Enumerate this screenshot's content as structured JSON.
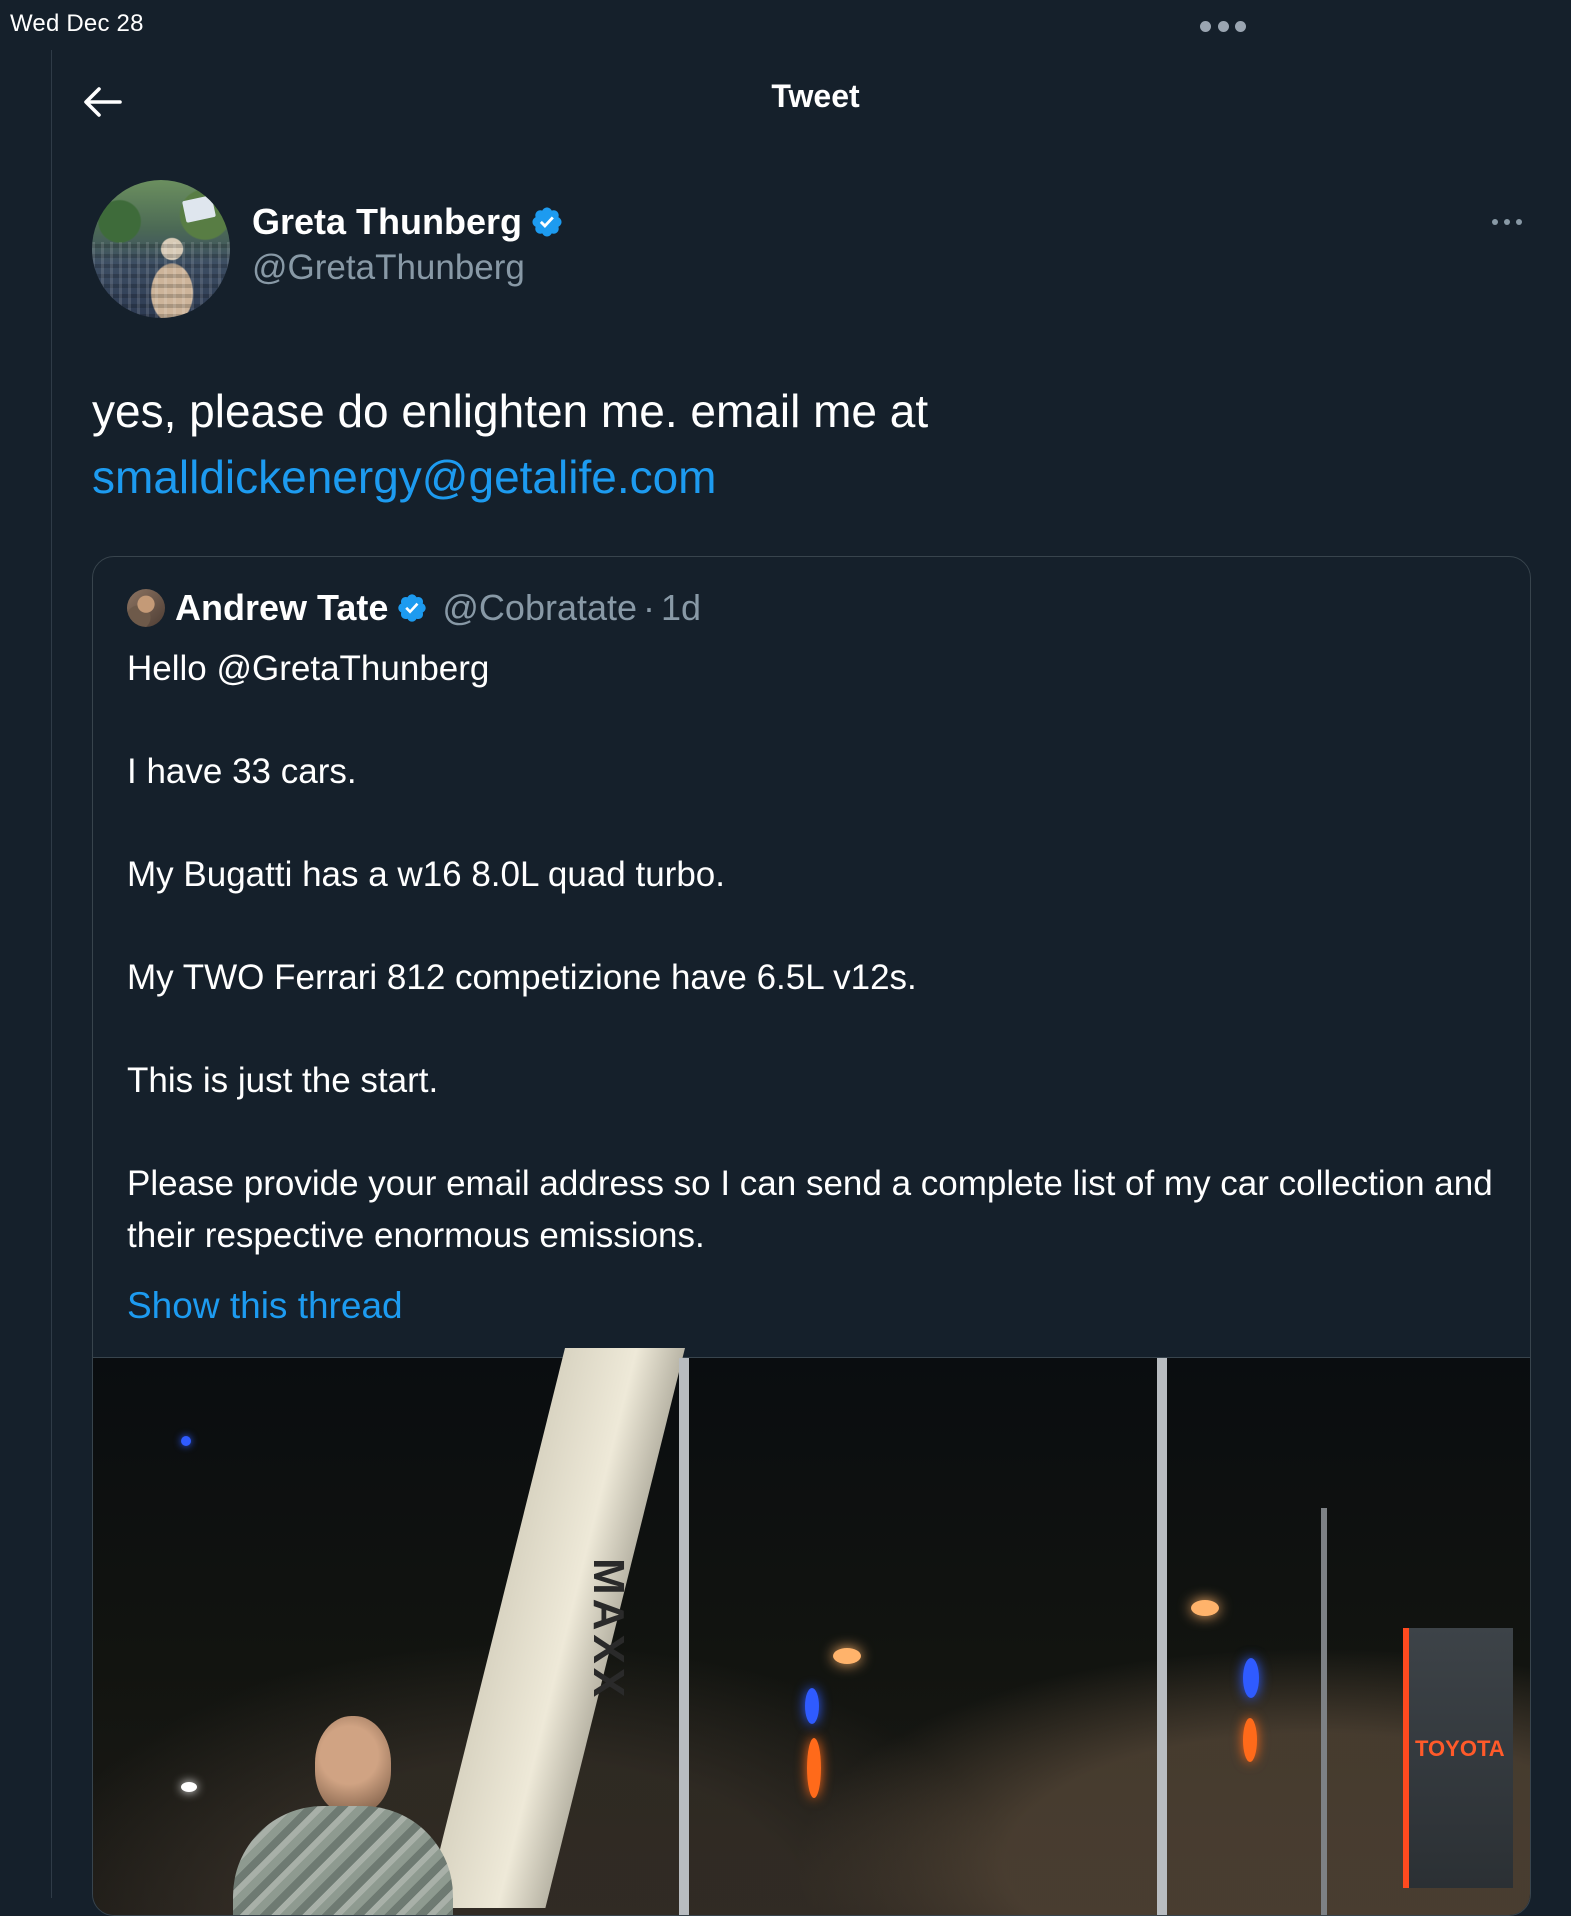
{
  "status_bar": {
    "time": "Wed Dec 28"
  },
  "nav": {
    "title": "Tweet",
    "back_icon": "arrow-left-icon"
  },
  "tweet": {
    "author": {
      "display_name": "Greta Thunberg",
      "handle": "@GretaThunberg",
      "verified": true
    },
    "text": "yes, please do enlighten me. email me at",
    "link_text": "smalldickenergy@getalife.com"
  },
  "quoted_tweet": {
    "author": {
      "display_name": "Andrew Tate",
      "handle": "@Cobratate",
      "separator": "·",
      "time": "1d",
      "verified": true
    },
    "paragraphs": [
      "Hello @GretaThunberg",
      "I have 33 cars.",
      "My Bugatti has a w16 8.0L quad turbo.",
      "My TWO Ferrari 812 competizione have 6.5L v12s.",
      "This is just the start.",
      "Please provide your email address so I can send a complete list of my car collection and their respective enormous emissions."
    ],
    "show_thread": "Show this thread",
    "media": {
      "banner_text": "MAXX",
      "sign_text": "TOYOTA"
    }
  },
  "colors": {
    "background": "#15202b",
    "link": "#1d9bf0",
    "secondary_text": "#8899a6",
    "border": "#38444d"
  }
}
